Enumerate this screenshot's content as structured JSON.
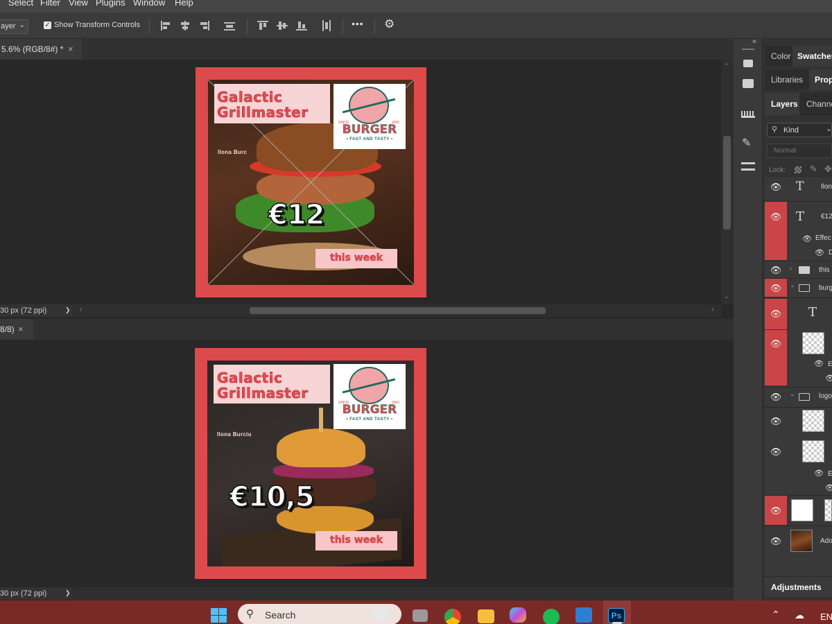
{
  "menu": [
    "Select",
    "Filter",
    "View",
    "Plugins",
    "Window",
    "Help"
  ],
  "options": {
    "layer_dropdown": "ayer",
    "show_transform_label": "Show Transform Controls",
    "show_transform_checked": true,
    "more_label": "•••"
  },
  "doc1": {
    "tab_title": "5.6% (RGB/8#) *",
    "close": "×",
    "status": "30 px (72 ppi)",
    "status_arrow": "❯"
  },
  "doc2": {
    "tab_title": "8/8)",
    "close": "×",
    "status": "30 px (72 ppi)",
    "status_arrow": "❯"
  },
  "poster1": {
    "title_line1": "Galactic",
    "title_line2": "Grillmaster",
    "author": "Ilona Burc",
    "price": "€12",
    "week": "this week",
    "logo_brand": "BURGER",
    "logo_tag": "• FAST AND TASTY •",
    "logo_since": "SINCE",
    "logo_year": "1950"
  },
  "poster2": {
    "title_line1": "Galactic",
    "title_line2": "Grillmaster",
    "author": "Ilona Burciu",
    "price": "€10,5",
    "week": "this week",
    "logo_brand": "BURGER",
    "logo_tag": "• FAST AND TASTY •",
    "logo_since": "SINCE",
    "logo_year": "1950"
  },
  "panel": {
    "collapse": "«",
    "tabs_row1": [
      "Color",
      "Swatches"
    ],
    "tabs_row2": [
      "Libraries",
      "Prop"
    ],
    "tabs_row3": [
      "Layers",
      "Channe"
    ],
    "kind_label": "Kind",
    "blend_mode": "Normal",
    "lock_label": "Lock:",
    "adjustments": "Adjustments"
  },
  "layers": [
    {
      "name": "Ilon",
      "type": "text",
      "highlighted": false
    },
    {
      "name": "€12",
      "type": "text",
      "highlighted": true
    },
    {
      "name": "Effec",
      "type": "effects",
      "highlighted": true
    },
    {
      "name": "D",
      "type": "effect",
      "highlighted": true
    },
    {
      "name": "this",
      "type": "group",
      "highlighted": false
    },
    {
      "name": "burg",
      "type": "group",
      "highlighted": true
    },
    {
      "name": "",
      "type": "text",
      "highlighted": true
    },
    {
      "name": "",
      "type": "smart",
      "highlighted": true
    },
    {
      "name": "E",
      "type": "effects",
      "highlighted": true
    },
    {
      "name": "logo",
      "type": "group",
      "highlighted": false
    },
    {
      "name": "",
      "type": "smart",
      "highlighted": false
    },
    {
      "name": "",
      "type": "smart",
      "highlighted": false
    },
    {
      "name": "E",
      "type": "effects",
      "highlighted": false
    },
    {
      "name": "",
      "type": "mask",
      "highlighted": true
    },
    {
      "name": "Ado",
      "type": "image",
      "highlighted": false
    }
  ],
  "taskbar": {
    "search_placeholder": "Search",
    "lang": "EN"
  },
  "colors": {
    "poster_red": "#dd4a4c",
    "title_pink": "#f7d4d6",
    "layer_highlight": "#c94547",
    "taskbar": "#7a2a26"
  }
}
